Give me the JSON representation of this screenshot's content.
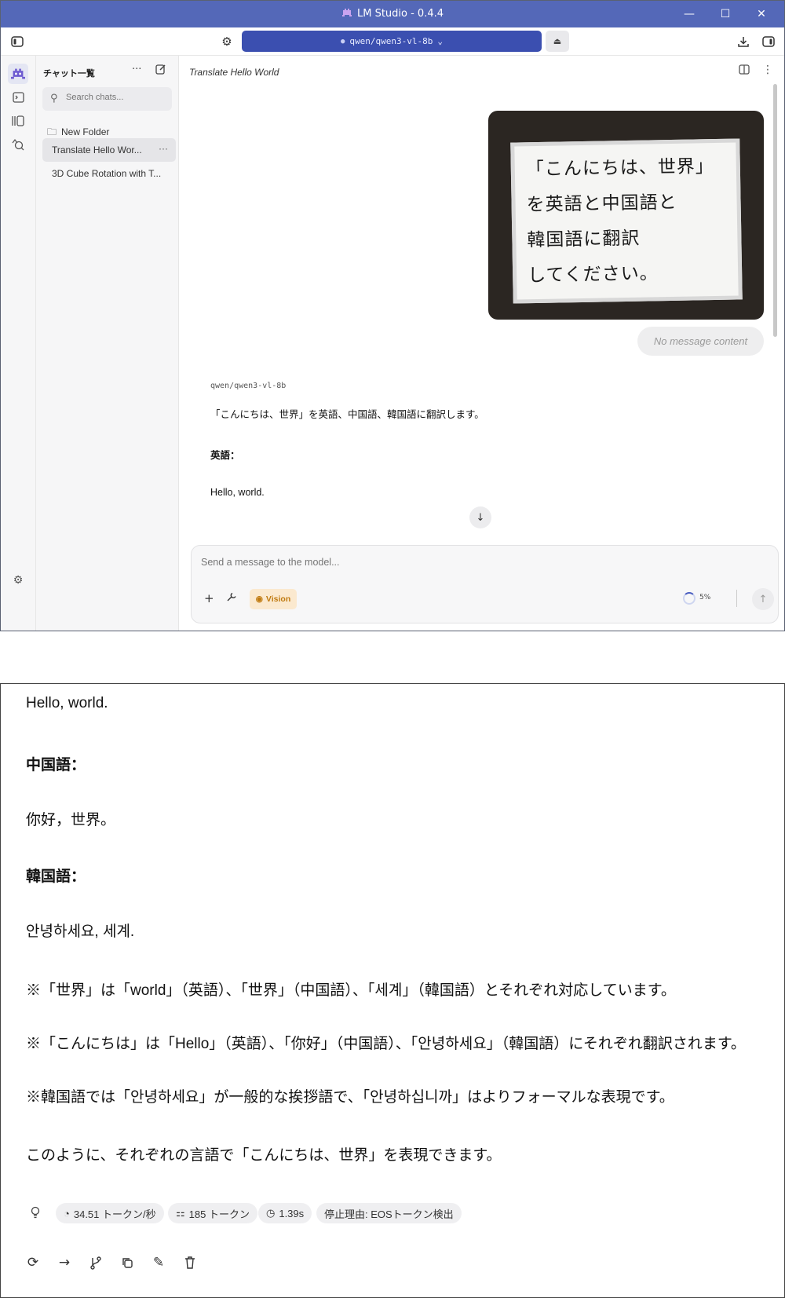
{
  "window": {
    "title": "LM Studio - 0.4.4",
    "controls": {
      "minimize": "—",
      "maximize": "☐",
      "close": "✕"
    }
  },
  "toolbar": {
    "model_name": "qwen/qwen3-vl-8b",
    "model_chevron": "⌄"
  },
  "rail": {
    "items": [
      "chat-icon",
      "terminal-icon",
      "models-icon",
      "discover-icon"
    ],
    "settings": "gear-icon"
  },
  "sidebar": {
    "heading": "チャット一覧",
    "more": "···",
    "search_placeholder": "Search chats...",
    "new_folder": "New Folder",
    "chats": [
      {
        "label": "Translate Hello Wor...",
        "more": "···"
      },
      {
        "label": "3D Cube Rotation with T..."
      }
    ]
  },
  "main": {
    "chat_title": "Translate Hello World",
    "image_text": [
      "「こんにちは、世界」",
      "を英語と中国語と",
      "韓国語に翻訳",
      "してください。"
    ],
    "no_content": "No message content",
    "model_tag": "qwen/qwen3-vl-8b",
    "reply_intro": "「こんにちは、世界」を英語、中国語、韓国語に翻訳します。",
    "reply_en_head": "英語：",
    "reply_en": "Hello, world."
  },
  "composer": {
    "placeholder": "Send a message to the model...",
    "add": "+",
    "vision_label": "Vision",
    "context_pct": "5%"
  },
  "continued": {
    "en": "Hello, world.",
    "zh_head": "中国語：",
    "zh": "你好，世界。",
    "ko_head": "韓国語：",
    "ko": "안녕하세요, 세계.",
    "note1": "※「世界」は「world」（英語）、「世界」（中国語）、「세계」（韓国語）とそれぞれ対応しています。",
    "note2": "※「こんにちは」は「Hello」（英語）、「你好」（中国語）、「안녕하세요」（韓国語）にそれぞれ翻訳されます。",
    "note3": "※韓国語では「안녕하세요」が一般的な挨拶語で、「안녕하십니까」はよりフォーマルな表現です。",
    "closing": "このように、それぞれの言語で「こんにちは、世界」を表現できます。"
  },
  "stats": {
    "speed": "34.51 トークン/秒",
    "tokens": "185 トークン",
    "time": "1.39s",
    "stop_reason": "停止理由: EOSトークン検出"
  },
  "colors": {
    "titlebar": "#5468b8",
    "model_pill": "#3b4fb0",
    "vision_bg": "#fbe9cf",
    "vision_text": "#c07a10"
  }
}
